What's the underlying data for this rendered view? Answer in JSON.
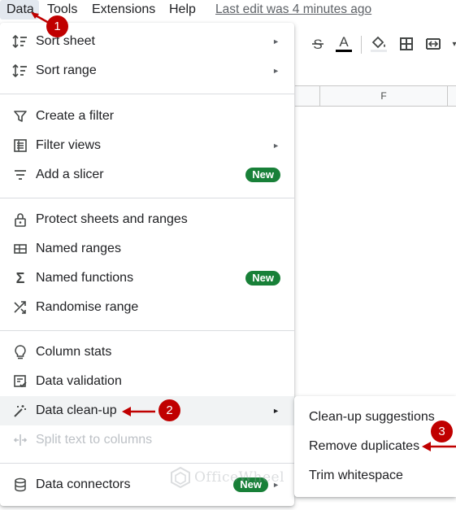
{
  "menubar": {
    "items": [
      "Data",
      "Tools",
      "Extensions",
      "Help"
    ],
    "last_edit": "Last edit was 4 minutes ago"
  },
  "sheet": {
    "column_header": "F",
    "toolbar_icons": [
      "strikethrough-icon",
      "text-color-icon",
      "fill-color-icon",
      "borders-icon",
      "merge-cells-icon"
    ]
  },
  "data_menu": {
    "items": [
      {
        "label": "Sort sheet",
        "icon": "sort-icon",
        "submenu": true
      },
      {
        "label": "Sort range",
        "icon": "sort-icon",
        "submenu": true
      },
      {
        "label": "Create a filter",
        "icon": "filter-icon"
      },
      {
        "label": "Filter views",
        "icon": "filter-views-icon",
        "submenu": true
      },
      {
        "label": "Add a slicer",
        "icon": "slicer-icon",
        "badge": "New"
      },
      {
        "label": "Protect sheets and ranges",
        "icon": "lock-icon"
      },
      {
        "label": "Named ranges",
        "icon": "named-ranges-icon"
      },
      {
        "label": "Named functions",
        "icon": "sigma-icon",
        "badge": "New"
      },
      {
        "label": "Randomise range",
        "icon": "shuffle-icon"
      },
      {
        "label": "Column stats",
        "icon": "lightbulb-icon"
      },
      {
        "label": "Data validation",
        "icon": "data-validation-icon"
      },
      {
        "label": "Data clean-up",
        "icon": "magic-wand-icon",
        "submenu": true,
        "highlighted": true
      },
      {
        "label": "Split text to columns",
        "icon": "split-icon",
        "disabled": true
      },
      {
        "label": "Data connectors",
        "icon": "database-icon",
        "badge": "New",
        "submenu": true
      }
    ]
  },
  "cleanup_submenu": {
    "items": [
      "Clean-up suggestions",
      "Remove duplicates",
      "Trim whitespace"
    ]
  },
  "annotations": {
    "steps": [
      "1",
      "2",
      "3"
    ],
    "color": "#c00000"
  },
  "watermark": "OfficeWheel",
  "colors": {
    "badge_green": "#188038",
    "highlight": "#f1f3f4",
    "menu_active": "#e3e8ef"
  }
}
